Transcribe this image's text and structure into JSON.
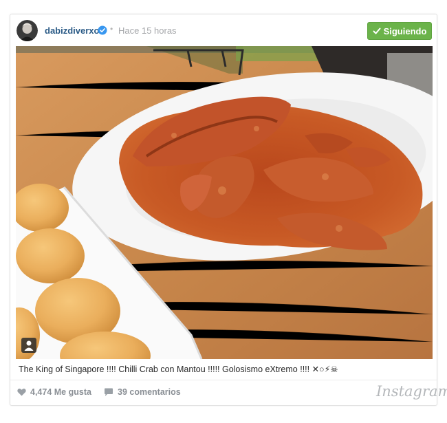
{
  "post": {
    "username": "dabizdiverxo",
    "separator": "•",
    "timestamp": "Hace 15 horas",
    "follow_label": "Siguiendo",
    "caption": "The King of Singapore !!!! Chilli Crab con Mantou !!!!! Golosismo eXtremo !!!! ✕○⚡☠",
    "likes": "4,474 Me gusta",
    "comments": "39 comentarios",
    "brand": "Instagram"
  },
  "colors": {
    "username": "#2a5a86",
    "follow_bg": "#6bb34a",
    "verified": "#3897f0",
    "muted": "#8a8f95"
  },
  "icons": {
    "verified": "verified-badge-icon",
    "follow": "checkmark-icon",
    "likes": "heart-icon",
    "comments": "speech-bubble-icon",
    "tagged": "person-tag-icon"
  }
}
